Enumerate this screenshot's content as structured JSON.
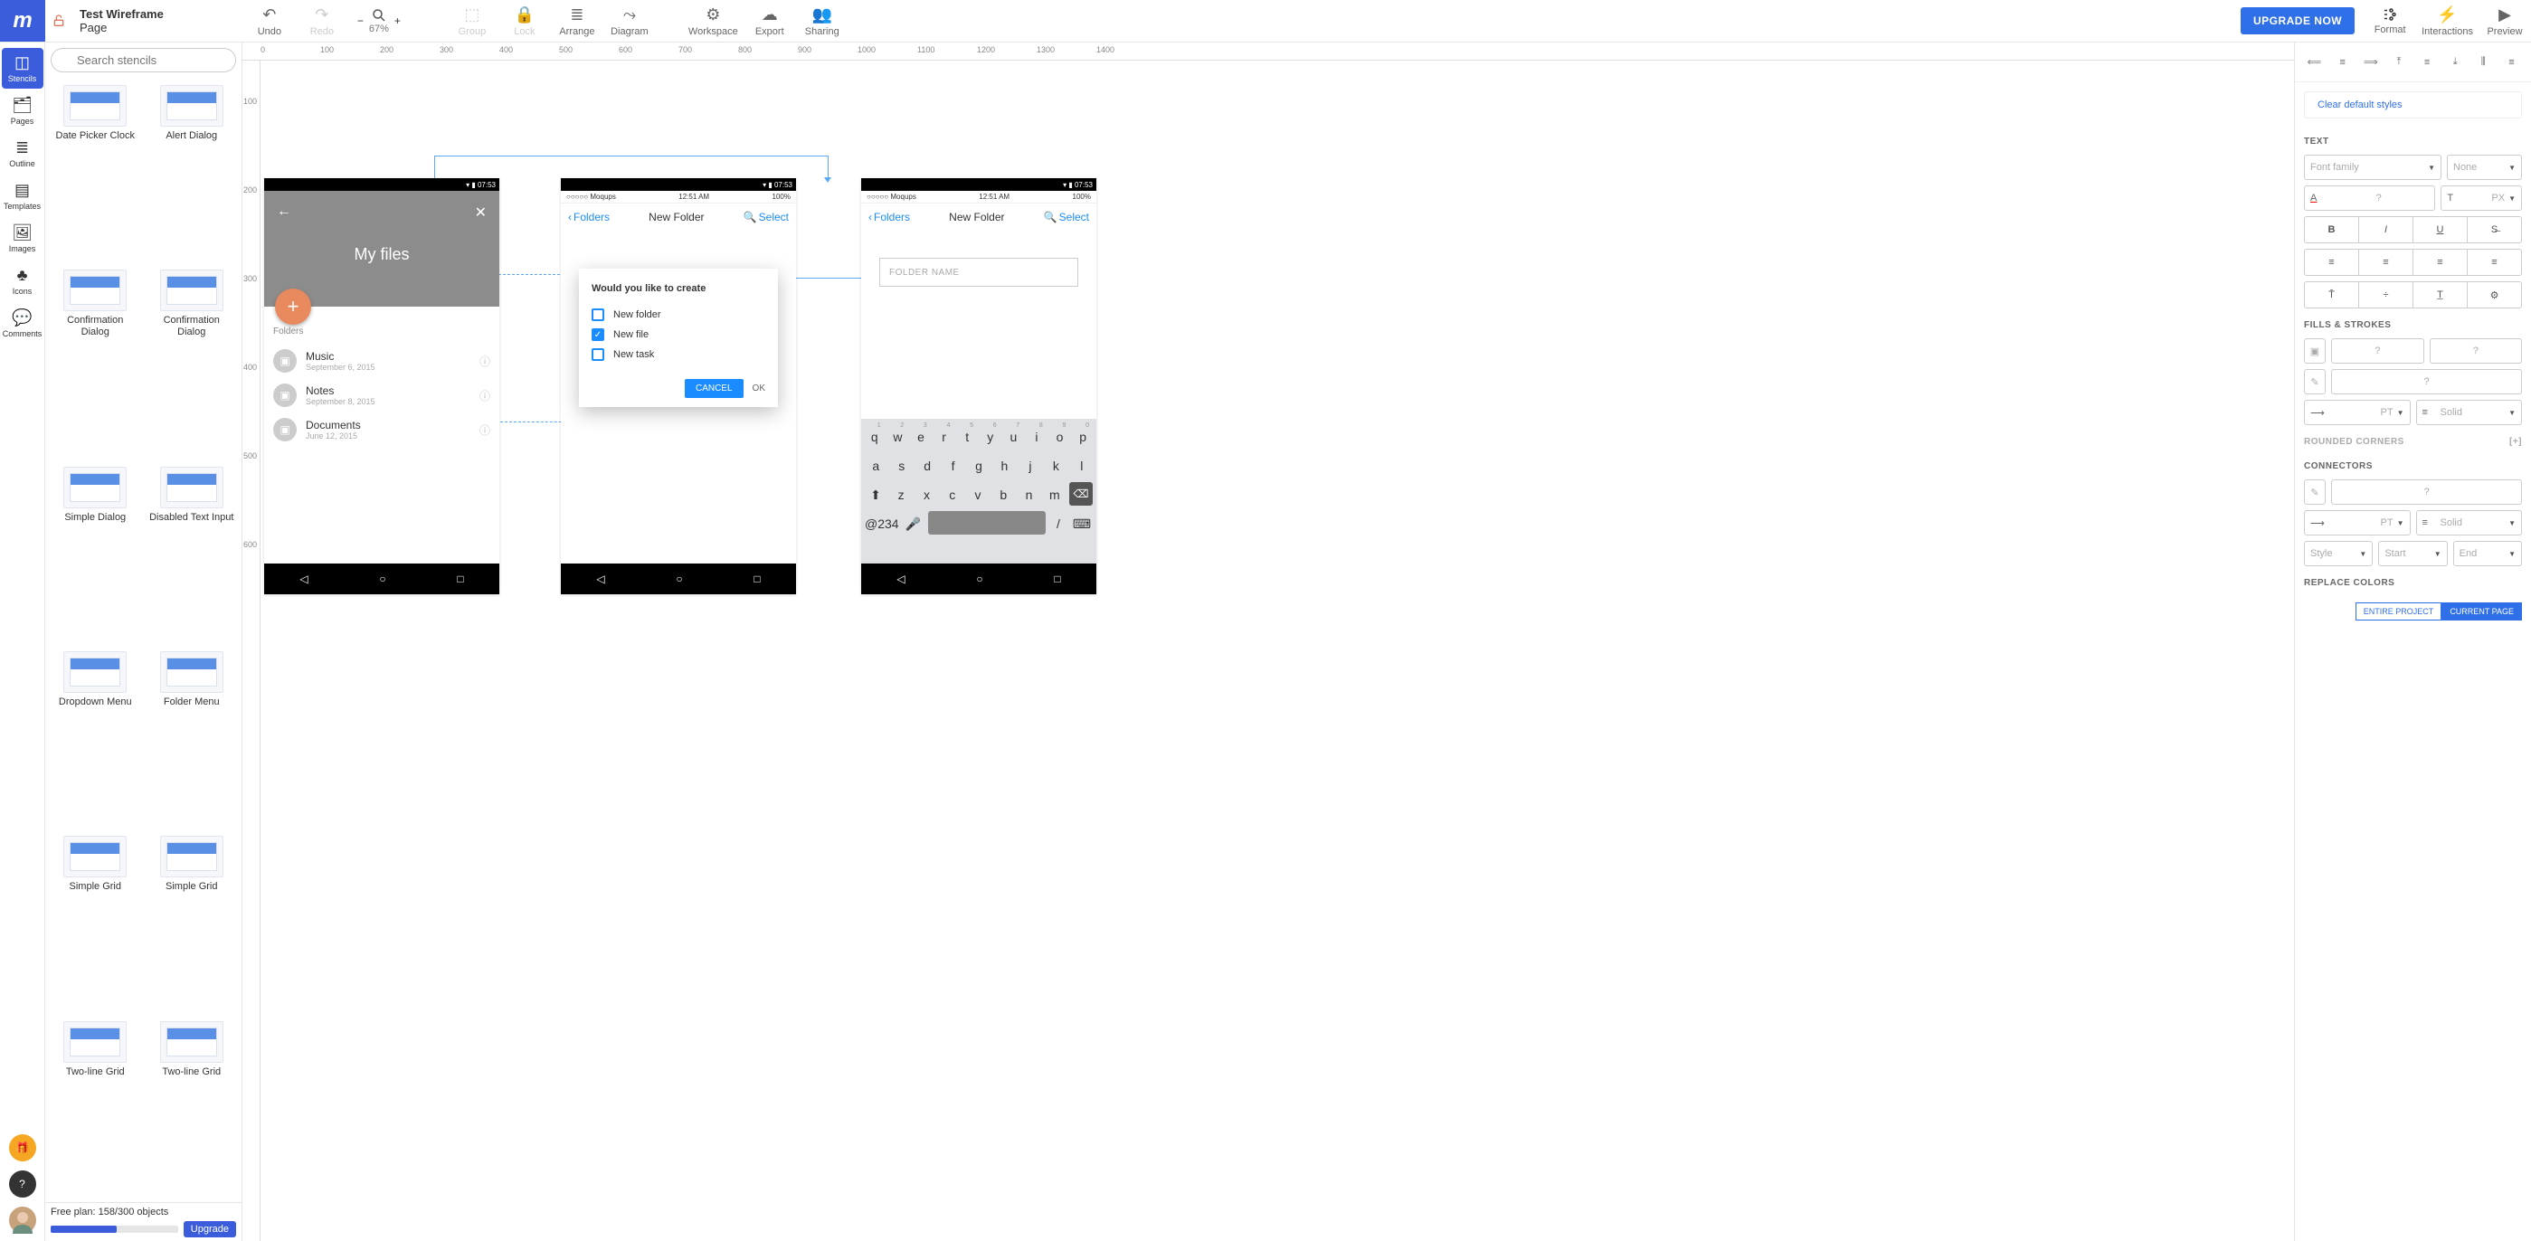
{
  "header": {
    "project_title": "Test Wireframe",
    "page_title": "Page",
    "toolbar": {
      "undo": "Undo",
      "redo": "Redo",
      "zoom_level": "67%",
      "group": "Group",
      "lock": "Lock",
      "arrange": "Arrange",
      "diagram": "Diagram",
      "workspace": "Workspace",
      "export": "Export",
      "sharing": "Sharing",
      "upgrade": "UPGRADE NOW",
      "format": "Format",
      "interactions": "Interactions",
      "preview": "Preview"
    }
  },
  "rail": {
    "stencils": "Stencils",
    "pages": "Pages",
    "outline": "Outline",
    "templates": "Templates",
    "images": "Images",
    "icons": "Icons",
    "comments": "Comments"
  },
  "stencils_panel": {
    "search_placeholder": "Search stencils",
    "items": [
      "Date Picker Clock",
      "Alert Dialog",
      "Confirmation Dialog",
      "Confirmation Dialog",
      "Simple Dialog",
      "Disabled Text Input",
      "Dropdown Menu",
      "Folder Menu",
      "Simple Grid",
      "Simple Grid",
      "Two-line Grid",
      "Two-line Grid"
    ]
  },
  "footer": {
    "plan_line": "Free plan: 158/300 objects",
    "upgrade": "Upgrade"
  },
  "ruler_h": [
    "0",
    "100",
    "200",
    "300",
    "400",
    "500",
    "600",
    "700",
    "800",
    "900",
    "1000",
    "1100",
    "1200",
    "1300",
    "1400"
  ],
  "ruler_v": [
    "100",
    "200",
    "300",
    "400",
    "500",
    "600"
  ],
  "canvas": {
    "phone1": {
      "title": "My files",
      "section_heading": "Folders",
      "items": [
        {
          "title": "Music",
          "sub": "September 6, 2015"
        },
        {
          "title": "Notes",
          "sub": "September 8, 2015"
        },
        {
          "title": "Documents",
          "sub": "June 12, 2015"
        }
      ]
    },
    "phone2": {
      "back_label": "Folders",
      "title": "New Folder",
      "action_label": "Select",
      "dialog": {
        "title": "Would you like to create",
        "opts": [
          "New folder",
          "New file",
          "New task"
        ],
        "cancel": "CANCEL",
        "ok": "OK"
      },
      "status": {
        "carrier": "○○○○○ Moqups",
        "time": "12:51 AM",
        "battery": "100%",
        "bt": "07:53"
      }
    },
    "phone3": {
      "back_label": "Folders",
      "title": "New Folder",
      "action_label": "Select",
      "placeholder": "FOLDER NAME",
      "status": {
        "carrier": "○○○○○ Moqups",
        "time": "12:51 AM",
        "battery": "100%",
        "bt": "07:53"
      },
      "keyboard": {
        "row1": [
          "q",
          "w",
          "e",
          "r",
          "t",
          "y",
          "u",
          "i",
          "o",
          "p"
        ],
        "row1_nums": [
          "1",
          "2",
          "3",
          "4",
          "5",
          "6",
          "7",
          "8",
          "9",
          "0"
        ],
        "row2": [
          "a",
          "s",
          "d",
          "f",
          "g",
          "h",
          "j",
          "k",
          "l"
        ],
        "row3": [
          "z",
          "x",
          "c",
          "v",
          "b",
          "n",
          "m"
        ],
        "bottom_left": "@234",
        "bottom_slash": "/"
      }
    }
  },
  "props": {
    "clear_styles": "Clear default styles",
    "sections": {
      "text": "TEXT",
      "fills": "FILLS & STROKES",
      "rounded": "ROUNDED CORNERS",
      "connectors": "CONNECTORS",
      "replace": "REPLACE COLORS"
    },
    "font_family_ph": "Font family",
    "none": "None",
    "question": "?",
    "px": "PX",
    "pt": "PT",
    "solid": "Solid",
    "style": "Style",
    "start": "Start",
    "end": "End",
    "entire": "ENTIRE PROJECT",
    "current": "CURRENT PAGE",
    "plus": "[+]"
  }
}
